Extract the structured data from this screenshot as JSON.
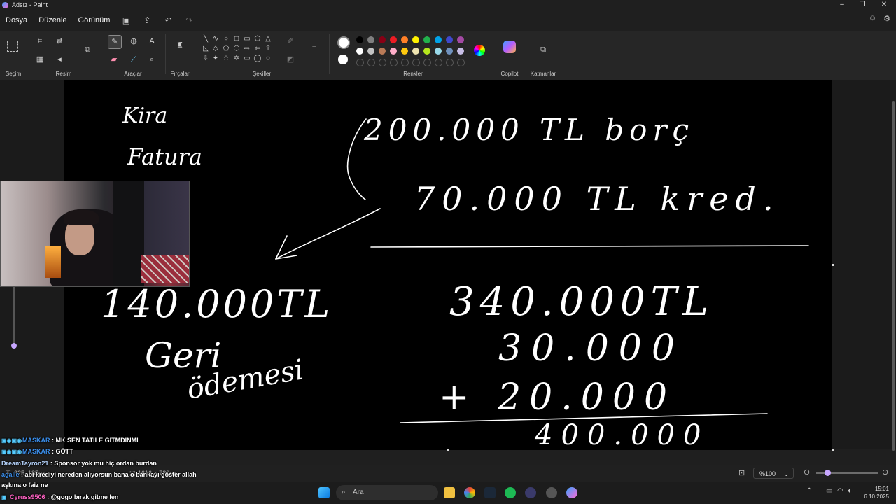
{
  "window": {
    "title": "Adsız - Paint"
  },
  "menu": {
    "items": [
      "Dosya",
      "Düzenle",
      "Görünüm"
    ]
  },
  "ribbon": {
    "groups": {
      "selection": "Seçim",
      "image": "Resim",
      "tools": "Araçlar",
      "brushes": "Fırçalar",
      "shapes": "Şekiller",
      "colors": "Renkler",
      "copilot": "Copilot",
      "layers": "Katmanlar"
    },
    "palette_row1": [
      "#000000",
      "#7f7f7f",
      "#880015",
      "#ed1c24",
      "#ff7f27",
      "#fff200",
      "#22b14c",
      "#00a2e8",
      "#3f48cc",
      "#a349a4"
    ],
    "palette_row2": [
      "#ffffff",
      "#c3c3c3",
      "#b97a57",
      "#ffaec9",
      "#ffc90e",
      "#efe4b0",
      "#b5e61d",
      "#99d9ea",
      "#7092be",
      "#c8bfe7"
    ]
  },
  "canvas_handwriting": {
    "left_list": [
      "Kira",
      "Fatura"
    ],
    "right_top": [
      "200.000 TL borç",
      "70.000 TL kred."
    ],
    "left_total": "140.000TL",
    "left_note": [
      "Geri",
      "ödemesi"
    ],
    "right_sum": [
      "340.000TL",
      "30.000",
      "+ 20.000"
    ],
    "right_result": "400.000"
  },
  "status": {
    "zoom": "%100",
    "cursor": "325, 185px",
    "canvas_size": "1616 × 780px"
  },
  "taskbar": {
    "search_placeholder": "Ara",
    "time": "15:01",
    "date": "6.10.2025"
  },
  "chat": [
    {
      "user": "MASKAR",
      "message": ": MK SEN TATİLE GİTMDİNMİ"
    },
    {
      "user": "MASKAR",
      "message": ": GÖTT"
    },
    {
      "user": "DreamTayron21",
      "message": ": Sponsor yok mu hiç ordan burdan"
    },
    {
      "user": "agalle",
      "message": ": abi krediyi nereden alıyorsun bana o bankayı göster allah"
    },
    {
      "user": "",
      "message": "aşkına o faiz ne"
    },
    {
      "user": "Cyruss9506",
      "message": ": @gogo bırak gitme len"
    }
  ],
  "colors": {
    "canvas": "#000000",
    "ink": "#ffffff",
    "accent": "#c7a6ff"
  }
}
